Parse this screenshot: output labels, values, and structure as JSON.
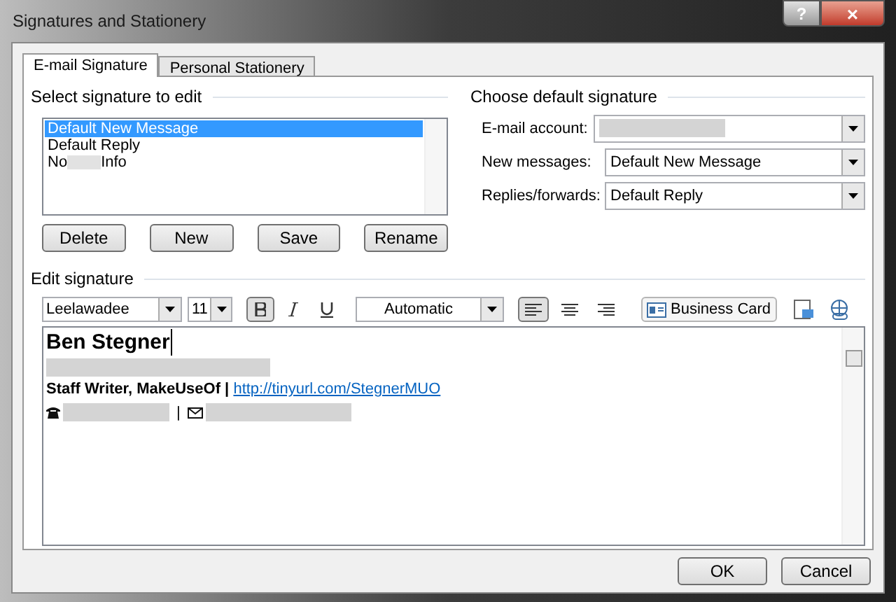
{
  "window": {
    "title": "Signatures and Stationery",
    "help": "?",
    "close": "×"
  },
  "tabs": [
    {
      "label": "E-mail Signature",
      "selected": true
    },
    {
      "label": "Personal Stationery",
      "selected": false
    }
  ],
  "select_signature": {
    "heading": "Select signature to edit",
    "items": [
      {
        "label": "Default New Message",
        "selected": true
      },
      {
        "label": "Default Reply",
        "selected": false
      },
      {
        "label": "No",
        "label_after": "Info",
        "redacted": true,
        "selected": false
      }
    ],
    "buttons": [
      "Delete",
      "New",
      "Save",
      "Rename"
    ]
  },
  "default_signature": {
    "heading": "Choose default signature",
    "fields": [
      {
        "label": "E-mail account:",
        "redacted": true
      },
      {
        "label": "New messages:",
        "value": "Default New Message",
        "redacted": false
      },
      {
        "label": "Replies/forwards:",
        "value": "Default Reply",
        "redacted": false
      }
    ]
  },
  "edit_signature": {
    "heading": "Edit signature",
    "font": "Leelawadee",
    "size": "11",
    "bold_on": true,
    "font_color_label": "Automatic",
    "alignment": [
      {
        "kind": "left",
        "selected": true
      },
      {
        "kind": "center",
        "selected": false
      },
      {
        "kind": "right",
        "selected": false
      }
    ],
    "business_card": "Business Card",
    "name": "Ben Stegner",
    "title": "Staff Writer, MakeUseOf | ",
    "link": "http://tinyurl.com/StegnerMUO",
    "separator": "|"
  },
  "footer_buttons": [
    "OK",
    "Cancel"
  ]
}
